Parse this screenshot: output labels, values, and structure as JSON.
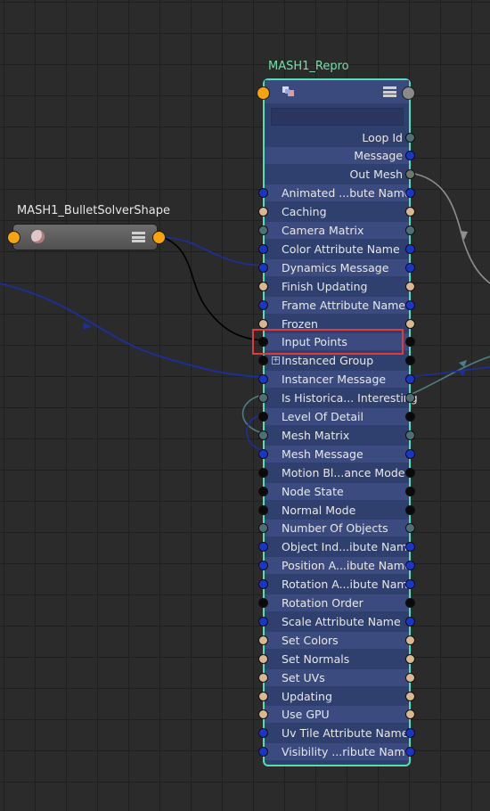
{
  "nodes": {
    "bullet": {
      "title": "MASH1_BulletSolverShape",
      "icon": "solver-icon",
      "menu_icon": "menu-icon"
    },
    "repro": {
      "title": "MASH1_Repro",
      "icon": "repro-icon",
      "menu_icon": "menu-icon",
      "search_value": "",
      "outputs": [
        {
          "label": "Loop Id",
          "port": "gray"
        },
        {
          "label": "Message",
          "port": "blue"
        },
        {
          "label": "Out Mesh",
          "port": "olive"
        }
      ],
      "attributes": [
        {
          "label": "Animated ...bute Name",
          "port": "blue"
        },
        {
          "label": "Caching",
          "port": "tan"
        },
        {
          "label": "Camera Matrix",
          "port": "gray"
        },
        {
          "label": "Color Attribute Name",
          "port": "blue"
        },
        {
          "label": "Dynamics Message",
          "port": "blue"
        },
        {
          "label": "Finish Updating",
          "port": "tan"
        },
        {
          "label": "Frame Attribute Name",
          "port": "blue"
        },
        {
          "label": "Frozen",
          "port": "tan"
        },
        {
          "label": "Input Points",
          "port": "black"
        },
        {
          "label": "Instanced Group",
          "port": "black",
          "expandable": true
        },
        {
          "label": "Instancer Message",
          "port": "blue"
        },
        {
          "label": "Is Historica... Interesting",
          "port": "gray"
        },
        {
          "label": "Level Of Detail",
          "port": "black"
        },
        {
          "label": "Mesh Matrix",
          "port": "gray"
        },
        {
          "label": "Mesh Message",
          "port": "blue"
        },
        {
          "label": "Motion Bl...ance Mode",
          "port": "black"
        },
        {
          "label": "Node State",
          "port": "black"
        },
        {
          "label": "Normal Mode",
          "port": "black"
        },
        {
          "label": "Number Of Objects",
          "port": "gray"
        },
        {
          "label": "Object Ind...ibute Name",
          "port": "blue"
        },
        {
          "label": "Position A...ibute Name",
          "port": "blue"
        },
        {
          "label": "Rotation A...ibute Name",
          "port": "blue"
        },
        {
          "label": "Rotation Order",
          "port": "black"
        },
        {
          "label": "Scale Attribute Name",
          "port": "blue"
        },
        {
          "label": "Set Colors",
          "port": "tan"
        },
        {
          "label": "Set Normals",
          "port": "tan"
        },
        {
          "label": "Set UVs",
          "port": "tan"
        },
        {
          "label": "Updating",
          "port": "tan"
        },
        {
          "label": "Use GPU",
          "port": "tan"
        },
        {
          "label": "Uv Tile Attribute Name",
          "port": "blue"
        },
        {
          "label": "Visibility ...ribute Name",
          "port": "blue"
        }
      ]
    }
  },
  "highlight": {
    "attribute": "Input Points",
    "color": "#e23a3a"
  },
  "colors": {
    "background": "#2b2b2b",
    "grid": "#1f1f1f",
    "node_border": "#54dfb0",
    "node_title": "#6fe3a8",
    "port_orange": "#f5a30f",
    "port_blue": "#1a36c8",
    "port_tan": "#d8b891",
    "port_gray": "#4e6f75",
    "port_black": "#0a0a0a",
    "wire_blue": "#1b2fa0",
    "wire_gray": "#8e8e8e",
    "wire_teal": "#4f7f83"
  }
}
